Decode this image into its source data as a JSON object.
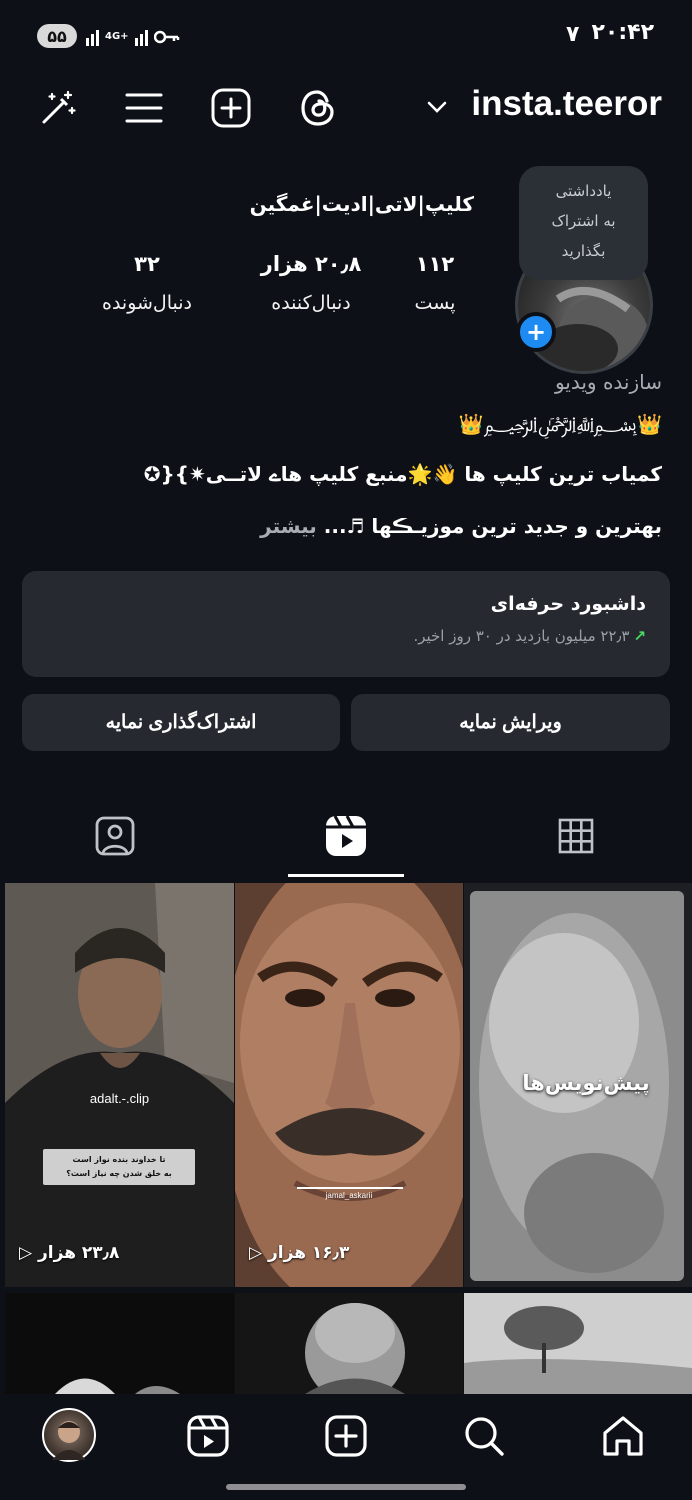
{
  "status_bar": {
    "battery": "۵۵",
    "network": "4G+",
    "time": "۲۰:۴۲",
    "extra": "۷"
  },
  "header": {
    "username": "insta.teeror",
    "icons": [
      "sparkle-wand-icon",
      "menu-icon",
      "create-plus-icon",
      "threads-icon",
      "chevron-down-icon"
    ]
  },
  "profile": {
    "note_bubble": [
      "یادداشتی",
      "به اشتراک",
      "بگذارید"
    ],
    "display_name": "کلیپ|لاتی|ادیت|غمگین",
    "stats": [
      {
        "value": "۱۱۲",
        "label": "پست"
      },
      {
        "value": "۲۰٫۸ هزار",
        "label": "دنبال‌کننده"
      },
      {
        "value": "۳۲",
        "label": "دنبال‌شونده"
      }
    ],
    "category": "سازنده ویدیو",
    "crown_line": "👑﷽👑",
    "bio_line_1": "کمیاب ترین کلیپ ها 👋🌟منبع کلیپ هاے لاتــی✷}{✪",
    "bio_line_2": "بهترین و جدید ترین موزیـڪها ♬...",
    "bio_more": "بیشتر"
  },
  "dashboard": {
    "title": "داشبورد حرفه‌ای",
    "subtitle": "۲۲٫۳ میلیون بازدید در ۳۰ روز اخیر.",
    "arrow": "↗"
  },
  "buttons": {
    "edit_profile": "ویرایش نمایه",
    "share_profile": "اشتراک‌گذاری نمایه"
  },
  "tabs": {
    "active": "reels",
    "items": [
      "grid-icon",
      "reels-icon",
      "tagged-icon"
    ]
  },
  "grid": {
    "draft_label": "پیش‌نویس‌ها",
    "reel1": {
      "views": "۱۶٫۳ هزار",
      "watermark": "jamal_askarii"
    },
    "reel2": {
      "views": "۲۳٫۸ هزار",
      "watermark": "adalt.-.clip",
      "caption": "تا خداوند بنده نواز است\nبه خلق شدن چه نیاز است؟"
    }
  },
  "bottom_nav": [
    "home-icon",
    "search-icon",
    "create-icon",
    "reels-icon",
    "profile-avatar"
  ]
}
